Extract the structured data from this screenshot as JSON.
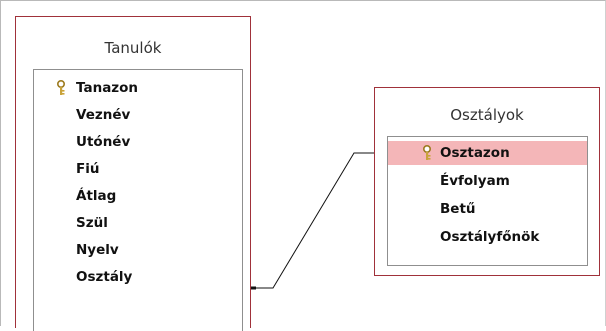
{
  "tables": {
    "tanulok": {
      "title": "Tanulók",
      "fields": [
        "Tanazon",
        "Veznév",
        "Utónév",
        "Fiú",
        "Átlag",
        "Szül",
        "Nyelv",
        "Osztály"
      ],
      "key_field": "Tanazon",
      "key_icon": "key-icon"
    },
    "osztalyok": {
      "title": "Osztályok",
      "fields": [
        "Osztazon",
        "Évfolyam",
        "Betű",
        "Osztályfőnök"
      ],
      "key_field": "Osztazon",
      "key_icon": "key-icon",
      "selected_field": "Osztazon"
    }
  },
  "relationship": {
    "from": "Tanulók.Osztály",
    "to": "Osztályok.Osztazon"
  },
  "colors": {
    "table_border": "#a0313a",
    "selected_row": "#f4b6b8",
    "key_icon": "#c9a33a"
  }
}
